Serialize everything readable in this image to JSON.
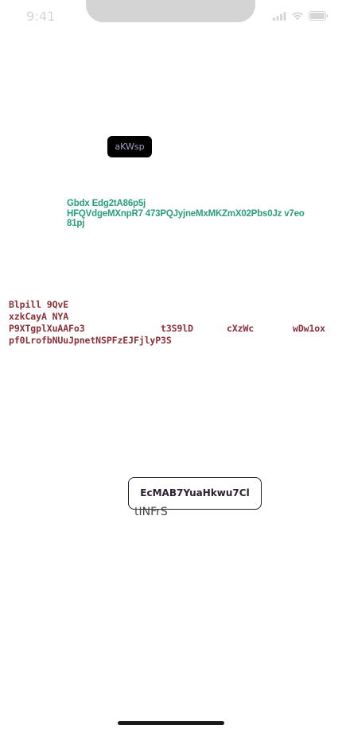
{
  "status_bar": {
    "time": "9:41",
    "icons": [
      "cellular-signal-icon",
      "wifi-icon",
      "battery-icon"
    ]
  },
  "chip": {
    "label": "aKWsp"
  },
  "green_text": {
    "lines": [
      "Gbdx Edg2tA86p5j",
      "HFQVdgeMXnpR7 473PQJyjneMxMKZmX02Pbs0Jz v7eo",
      "81pj"
    ]
  },
  "red_block": {
    "line1": "Blpill 9QvE",
    "line2": "xzkCayA NYA",
    "row3": [
      "P9XTgplXuAAFo3",
      "t3S9lD",
      "cXzWc",
      "wDw1ox"
    ],
    "line4": "pf0LrofbNUuJpnetNSPFzEJFjlyP3S"
  },
  "button": {
    "label": "EcMAB7YuaHkwu7Cl"
  },
  "under_label": "tINFrS",
  "colors": {
    "green": "#2a9d7c",
    "red": "#8c3038",
    "chip_bg": "#000000",
    "chip_text": "#a99ec2"
  }
}
